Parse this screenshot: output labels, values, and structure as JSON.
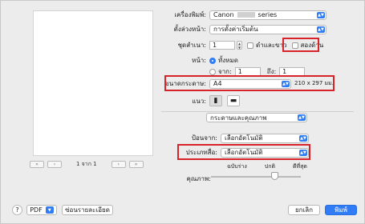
{
  "preview": {
    "page_indicator": "1 จาก 1"
  },
  "form": {
    "printer": {
      "label": "เครื่องพิมพ์:",
      "value": "Canon",
      "value_suffix": "series"
    },
    "presets": {
      "label": "ตั้งล่วงหน้า:",
      "value": "การตั้งค่าเริ่มต้น"
    },
    "copies": {
      "label": "ชุดสำเนา:",
      "value": "1",
      "bw_label": "ดำและขาว",
      "two_sided_label": "สองด้าน"
    },
    "pages": {
      "label": "หน้า:",
      "all_label": "ทั้งหมด",
      "from_label": "จาก:",
      "from_value": "1",
      "to_label": "ถึง:",
      "to_value": "1"
    },
    "paper_size": {
      "label": "ขนาดกระดาษ:",
      "value": "A4",
      "dimensions": "210 x 297 มม."
    },
    "orientation": {
      "label": "แนว:"
    },
    "section": {
      "value": "กระดาษและคุณภาพ"
    },
    "paper_source": {
      "label": "ป้อนจาก:",
      "value": "เลือกอัตโนมัติ"
    },
    "media_type": {
      "label": "ประเภทสื่อ:",
      "value": "เลือกอัตโนมัติ"
    },
    "quality": {
      "label": "คุณภาพ:",
      "draft": "ฉบับร่าง",
      "normal": "ปกติ",
      "high": "ดีที่สุด"
    }
  },
  "footer": {
    "help": "?",
    "pdf": "PDF",
    "hide_details": "ซ่อนรายละเอียด",
    "cancel": "ยกเลิก",
    "print": "พิมพ์"
  },
  "colors": {
    "accent": "#2f7cf6",
    "highlight_box": "#d8232a"
  }
}
